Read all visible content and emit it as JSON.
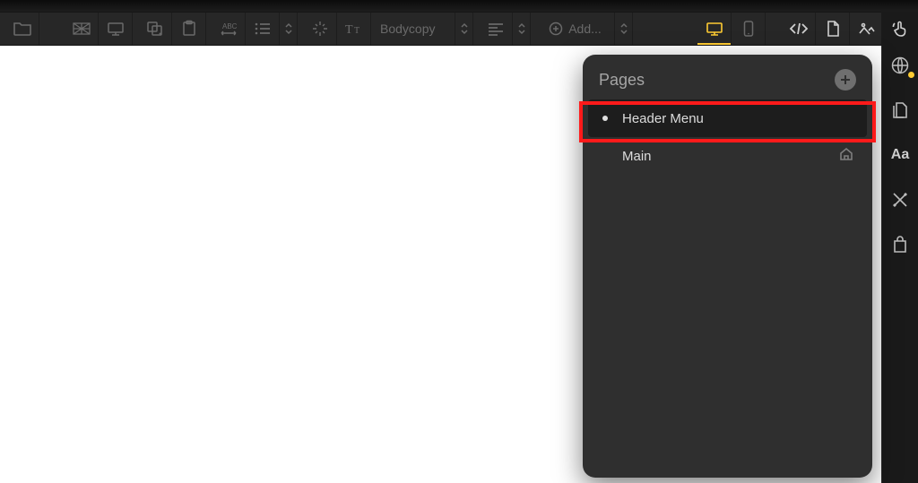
{
  "toolbar": {
    "bodycopy_label": "Bodycopy",
    "add_label": "Add..."
  },
  "rail": {
    "typography_label": "Aa"
  },
  "pages_panel": {
    "title": "Pages",
    "items": [
      {
        "label": "Header Menu",
        "selected": true,
        "home": false
      },
      {
        "label": "Main",
        "selected": false,
        "home": true
      }
    ]
  }
}
